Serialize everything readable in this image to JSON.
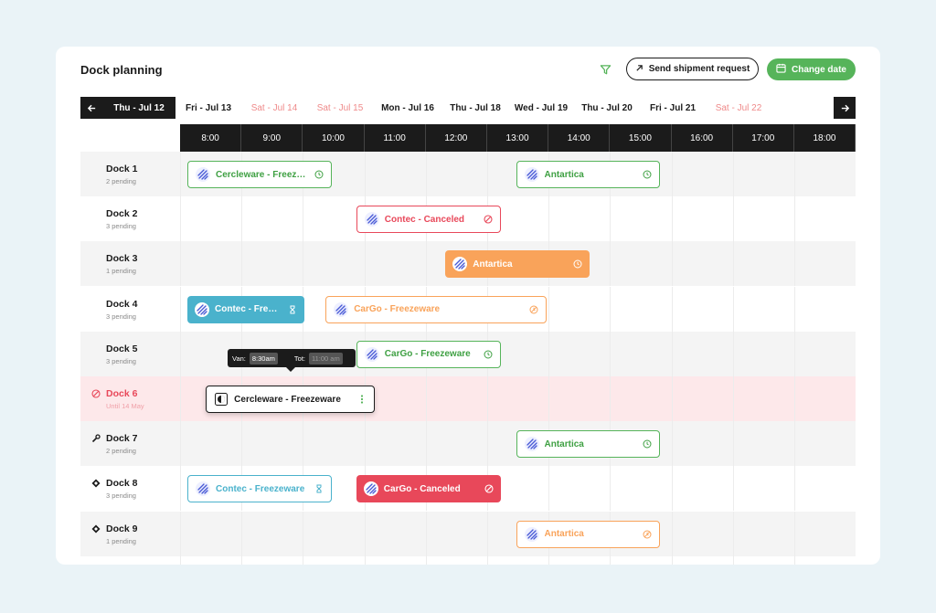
{
  "header": {
    "title": "Dock planning",
    "send_label": "Send shipment request",
    "change_label": "Change date"
  },
  "dates": [
    {
      "label": "Thu - Jul 12",
      "type": "active"
    },
    {
      "label": "Fri - Jul 13",
      "type": "normal"
    },
    {
      "label": "Sat - Jul 14",
      "type": "weekend"
    },
    {
      "label": "Sat - Jul 15",
      "type": "weekend"
    },
    {
      "label": "Mon - Jul 16",
      "type": "normal"
    },
    {
      "label": "Thu - Jul 18",
      "type": "normal"
    },
    {
      "label": "Wed - Jul 19",
      "type": "normal"
    },
    {
      "label": "Thu - Jul 20",
      "type": "normal"
    },
    {
      "label": "Fri - Jul 21",
      "type": "normal"
    },
    {
      "label": "Sat - Jul 22",
      "type": "weekend"
    }
  ],
  "hours": [
    "8:00",
    "9:00",
    "10:00",
    "11:00",
    "12:00",
    "13:00",
    "14:00",
    "15:00",
    "16:00",
    "17:00",
    "18:00"
  ],
  "docks": [
    {
      "name": "Dock 1",
      "sub": "2 pending",
      "bg": "gray",
      "icon": "",
      "slots": [
        {
          "label": "Cercleware - Freezeware",
          "style": "g-out",
          "status": "clock",
          "start": 0,
          "end": 2.35
        },
        {
          "label": "Antartica",
          "style": "g-out",
          "status": "clock",
          "start": 5.35,
          "end": 7.7
        }
      ]
    },
    {
      "name": "Dock 2",
      "sub": "3 pending",
      "bg": "white",
      "icon": "",
      "slots": [
        {
          "label": "Contec - Canceled",
          "style": "r-out",
          "status": "ban",
          "start": 2.75,
          "end": 5.1
        }
      ]
    },
    {
      "name": "Dock 3",
      "sub": "1 pending",
      "bg": "gray",
      "icon": "",
      "slots": [
        {
          "label": "Antartica",
          "style": "o-fill",
          "status": "clock",
          "start": 4.2,
          "end": 6.55
        }
      ]
    },
    {
      "name": "Dock 4",
      "sub": "3 pending",
      "bg": "white",
      "icon": "",
      "slots": [
        {
          "label": "Contec - Freezeware",
          "style": "b-fill",
          "status": "hourglass",
          "start": 0,
          "end": 1.9
        },
        {
          "label": "CarGo - Freezeware",
          "style": "o-out",
          "status": "alarm",
          "start": 2.25,
          "end": 5.85
        }
      ]
    },
    {
      "name": "Dock 5",
      "sub": "3 pending",
      "bg": "gray",
      "icon": "",
      "slots": [
        {
          "label": "CarGo - Freezeware",
          "style": "g-out",
          "status": "clock",
          "start": 2.75,
          "end": 5.1
        }
      ]
    },
    {
      "name": "Dock 6",
      "sub": "Until 14 May",
      "bg": "red",
      "icon": "ban",
      "slots": [
        {
          "label": "Cercleware - Freezeware",
          "style": "k-out",
          "status": "dots",
          "start": 0.3,
          "end": 3.05,
          "alt": true
        }
      ]
    },
    {
      "name": "Dock 7",
      "sub": "2 pending",
      "bg": "gray",
      "icon": "wrench",
      "slots": [
        {
          "label": "Antartica",
          "style": "g-out",
          "status": "clock",
          "start": 5.35,
          "end": 7.7
        }
      ]
    },
    {
      "name": "Dock 8",
      "sub": "3 pending",
      "bg": "white",
      "icon": "diamond",
      "slots": [
        {
          "label": "Contec - Freezeware",
          "style": "b-out",
          "status": "hourglass",
          "start": 0,
          "end": 2.35
        },
        {
          "label": "CarGo - Canceled",
          "style": "r-fill",
          "status": "ban",
          "start": 2.75,
          "end": 5.1
        }
      ]
    },
    {
      "name": "Dock 9",
      "sub": "1 pending",
      "bg": "gray",
      "icon": "diamond",
      "slots": [
        {
          "label": "Antartica",
          "style": "o-out",
          "status": "alarm",
          "start": 5.35,
          "end": 7.7
        }
      ]
    },
    {
      "name": "",
      "sub": "",
      "bg": "white",
      "icon": "",
      "slots": [
        {
          "label": "",
          "style": "o-out",
          "status": "",
          "start": 2.75,
          "end": 5.1
        }
      ]
    }
  ],
  "tooltip": {
    "van_label": "Van:",
    "van_value": "8:30am",
    "tot_label": "Tot:",
    "tot_value": "11:00 am"
  }
}
